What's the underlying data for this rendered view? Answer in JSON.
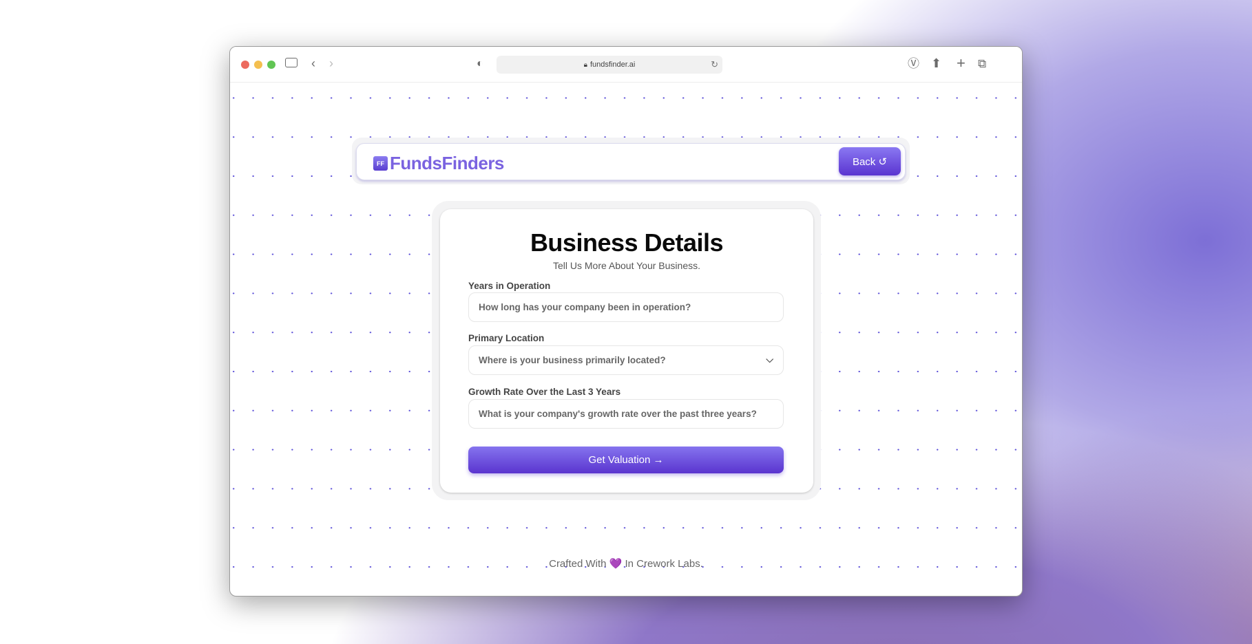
{
  "browser": {
    "url": "fundsfinder.ai"
  },
  "header": {
    "logo_mark": "FF",
    "logo_text": "FundsFinders",
    "back_label": "Back ↺"
  },
  "form": {
    "title": "Business Details",
    "subtitle": "Tell Us More About Your Business.",
    "fields": [
      {
        "label": "Years in Operation",
        "placeholder": "How long has your company been in operation?"
      },
      {
        "label": "Primary Location",
        "placeholder": "Where is your business primarily located?"
      },
      {
        "label": "Growth Rate Over the Last 3 Years",
        "placeholder": "What is your company's growth rate over the past three years?"
      }
    ],
    "submit_label": "Get Valuation →"
  },
  "footer": {
    "before": "Crafted With",
    "heart": "💜",
    "after": "In Crework Labs."
  },
  "colors": {
    "accent": "#6a4be0",
    "logo": "#7a63e0"
  }
}
